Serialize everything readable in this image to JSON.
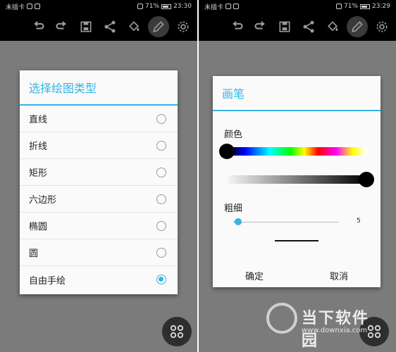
{
  "left_screen": {
    "statusbar": {
      "carrier": "未插卡",
      "battery": "71%",
      "time": "23:30"
    },
    "dialog": {
      "title": "选择绘图类型",
      "options": [
        {
          "label": "直线",
          "checked": false
        },
        {
          "label": "折线",
          "checked": false
        },
        {
          "label": "矩形",
          "checked": false
        },
        {
          "label": "六边形",
          "checked": false
        },
        {
          "label": "椭圆",
          "checked": false
        },
        {
          "label": "圆",
          "checked": false
        },
        {
          "label": "自由手绘",
          "checked": true
        }
      ]
    }
  },
  "right_screen": {
    "statusbar": {
      "carrier": "未插卡",
      "battery": "71%",
      "time": "23:29"
    },
    "dialog": {
      "title": "画笔",
      "color_label": "颜色",
      "thickness_label": "粗细",
      "thickness_value": "5",
      "confirm": "确定",
      "cancel": "取消"
    }
  },
  "toolbar_icons": [
    "undo-icon",
    "redo-icon",
    "save-icon",
    "share-icon",
    "fill-bucket-icon",
    "pencil-icon",
    "settings-icon"
  ],
  "accent_color": "#33b5e5",
  "watermark": {
    "text": "当下软件园",
    "url": "www.downxia.com"
  }
}
